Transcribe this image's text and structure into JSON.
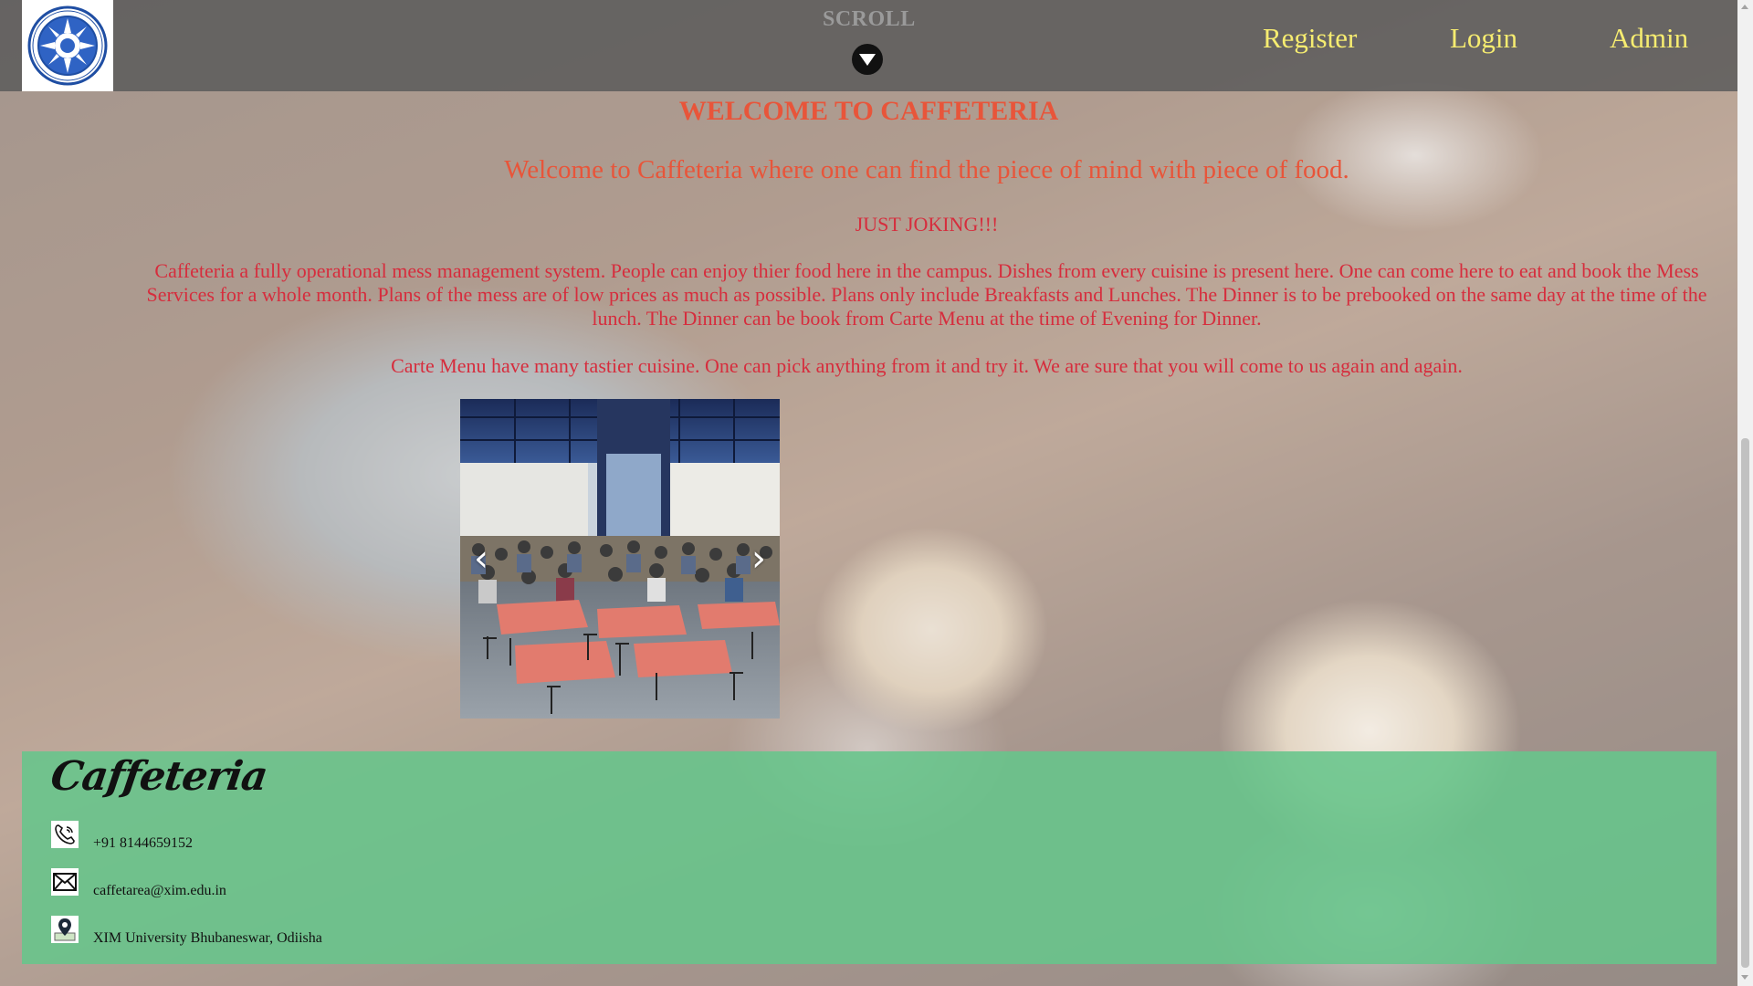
{
  "header": {
    "scroll_label": "SCROLL",
    "nav": {
      "register": "Register",
      "login": "Login",
      "admin": "Admin"
    },
    "logo_icon": "xim-university-seal-icon"
  },
  "main": {
    "title": "WELCOME TO CAFFETERIA",
    "subtitle": "Welcome to Caffeteria where one can find the piece of mind with piece of food.",
    "joke": "JUST JOKING!!!",
    "paragraph_1": "Caffeteria a fully operational mess management system. People can enjoy thier food here in the campus. Dishes from every cuisine is present here. One can come here to eat and book the Mess Services for a whole month. Plans of the mess are of low prices as much as possible. Plans only include Breakfasts and Lunches. The Dinner is to be prebooked on the same day at the time of the lunch. The Dinner can be book from Carte Menu at the time of Evening for Dinner.",
    "paragraph_2": "Carte Menu have many tastier cuisine. One can pick anything from it and try it. We are sure that you will come to us again and again.",
    "carousel": {
      "prev_glyph": "‹",
      "next_glyph": "›"
    }
  },
  "footer": {
    "brand": "Caffeteria",
    "phone": "+91 8144659152",
    "email": "caffetarea@xim.edu.in",
    "address": "XIM University Bhubaneswar, Odiisha"
  },
  "colors": {
    "nav_text": "#f6ec70",
    "title": "#e8553a",
    "body_text": "#d62d3d",
    "footer_bg": "#67c58b"
  }
}
